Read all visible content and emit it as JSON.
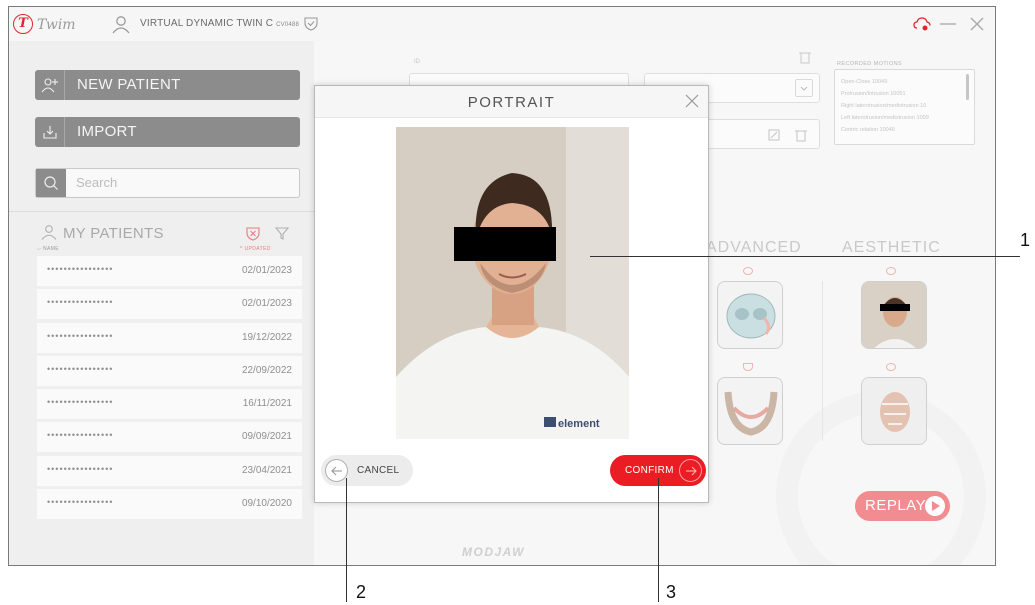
{
  "app": {
    "logo_letter": "T",
    "name": "Twim",
    "patient_title": "VIRTUAL DYNAMIC TWIN C",
    "patient_code": "CV0488"
  },
  "sidebar": {
    "new_patient_label": "NEW PATIENT",
    "import_label": "IMPORT",
    "search_placeholder": "Search",
    "my_patients_label": "MY PATIENTS",
    "sort_name_label": "NAME",
    "sort_updated_label": "UPDATED",
    "patients": [
      {
        "name": "••••••••••••••••",
        "date": "02/01/2023"
      },
      {
        "name": "••••••••••••••••",
        "date": "02/01/2023"
      },
      {
        "name": "••••••••••••••••",
        "date": "19/12/2022"
      },
      {
        "name": "••••••••••••••••",
        "date": "22/09/2022"
      },
      {
        "name": "••••••••••••••••",
        "date": "16/11/2021"
      },
      {
        "name": "••••••••••••••••",
        "date": "09/09/2021"
      },
      {
        "name": "••••••••••••••••",
        "date": "23/04/2021"
      },
      {
        "name": "••••••••••••••••",
        "date": "09/10/2020"
      }
    ]
  },
  "main": {
    "id_label": "ID",
    "recorded_motions_title": "RECORDED MOTIONS",
    "recorded_motions": [
      "Open-Close 10049",
      "Protrusion/Intrusion 10051",
      "Right laterotrusion/mediotrusion 10",
      "Left laterotrusion/mediotrusion 1009",
      "Centric relation 10049"
    ],
    "category_advanced": "ADVANCED",
    "category_aesthetic": "AESTHETIC",
    "replay_label": "REPLAY",
    "brand_footer": "MODJAW"
  },
  "modal": {
    "title": "PORTRAIT",
    "cancel_label": "CANCEL",
    "confirm_label": "CONFIRM",
    "shirt_brand": "element"
  },
  "callouts": [
    "1",
    "2",
    "3"
  ],
  "colors": {
    "accent_red": "#ea1c24",
    "dim_gray": "#8c8c8c"
  }
}
